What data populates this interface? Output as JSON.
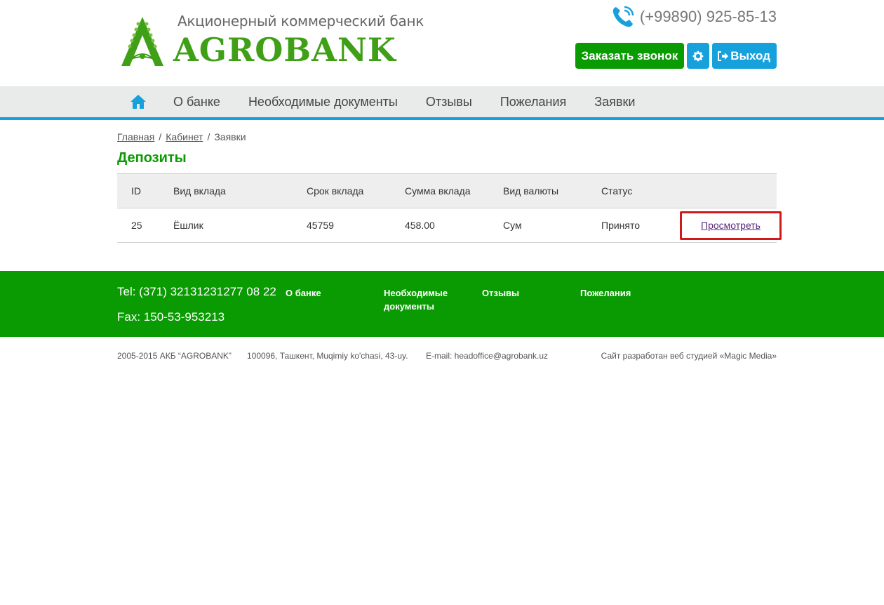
{
  "header": {
    "logo_tagline": "Акционерный коммерческий банк",
    "logo_text": "AGROBANK",
    "phone": "(+99890) 925-85-13",
    "order_call_label": "Заказать звонок",
    "exit_label": "Выход"
  },
  "nav": {
    "items": [
      {
        "label": "О банке"
      },
      {
        "label": "Необходимые документы"
      },
      {
        "label": "Отзывы"
      },
      {
        "label": "Пожелания"
      },
      {
        "label": "Заявки"
      }
    ]
  },
  "breadcrumb": {
    "home": "Главная",
    "cabinet": "Кабинет",
    "current": "Заявки",
    "separator": "/"
  },
  "page": {
    "title": "Депозиты"
  },
  "table": {
    "columns": [
      "ID",
      "Вид вклада",
      "Срок вклада",
      "Сумма вклада",
      "Вид валюты",
      "Статус"
    ],
    "rows": [
      {
        "id": "25",
        "type": "Ёшлик",
        "term": "45759",
        "amount": "458.00",
        "currency": "Сум",
        "status": "Принято",
        "action": "Просмотреть"
      }
    ]
  },
  "footer": {
    "tel": "Tel: (371) 32131231277 08 22",
    "fax": "Fax: 150-53-953213",
    "links": [
      "О банке",
      "Необходимые документы",
      "Отзывы",
      "Пожелания"
    ]
  },
  "bottom": {
    "copyright": "2005-2015 АКБ “AGROBANK”",
    "address": "100096, Ташкент, Muqimiy ko'chasi, 43-uy.",
    "email": "E-mail: headoffice@agrobank.uz",
    "credits": "Сайт разработан веб студией «Magic Media»"
  },
  "colors": {
    "brand_green": "#0a9b03",
    "accent_blue": "#16a1dd",
    "highlight_red": "#d0191b"
  },
  "icons": [
    "phone-icon",
    "gear-icon",
    "sign-out-icon",
    "home-icon"
  ]
}
